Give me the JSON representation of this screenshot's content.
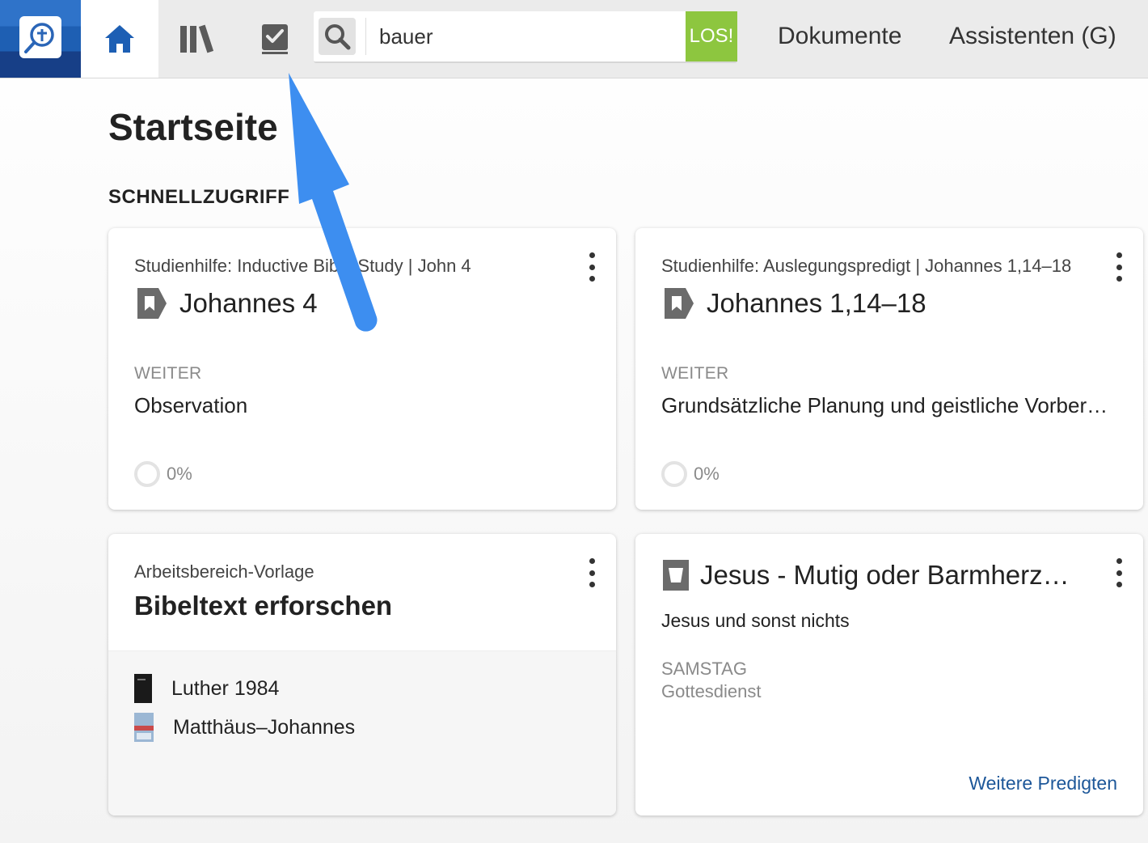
{
  "topbar": {
    "search_value": "bauer",
    "go_label": "LOS!",
    "documents_label": "Dokumente",
    "assistants_label": "Assistenten (G)",
    "icons": [
      "logos-logo-icon",
      "home-icon",
      "library-icon",
      "checklist-icon",
      "search-icon"
    ],
    "colors": {
      "accent_blue": "#1d5fb4",
      "go_green": "#8dc63f"
    }
  },
  "page": {
    "title": "Startseite",
    "section_title": "SCHNELLZUGRIFF"
  },
  "cards": {
    "c1": {
      "subtitle": "Studienhilfe: Inductive Bible Study | John 4",
      "title": "Johannes 4",
      "continue_label": "WEITER",
      "continue_value": "Observation",
      "progress": "0%"
    },
    "c2": {
      "subtitle": "Studienhilfe: Auslegungspredigt | Johannes 1,14–18",
      "title": "Johannes 1,14–18",
      "continue_label": "WEITER",
      "continue_value": "Grundsätzliche Planung und geistliche Vorber…",
      "progress": "0%"
    },
    "c3": {
      "subtitle": "Arbeitsbereich-Vorlage",
      "title": "Bibeltext erforschen",
      "resources": [
        {
          "label": "Luther 1984"
        },
        {
          "label": "Matthäus–Johannes"
        }
      ]
    },
    "c4": {
      "title": "Jesus - Mutig oder Barmherz…",
      "subtitle": "Jesus und sonst nichts",
      "day": "SAMSTAG",
      "event": "Gottesdienst",
      "link": "Weitere Predigten"
    }
  }
}
